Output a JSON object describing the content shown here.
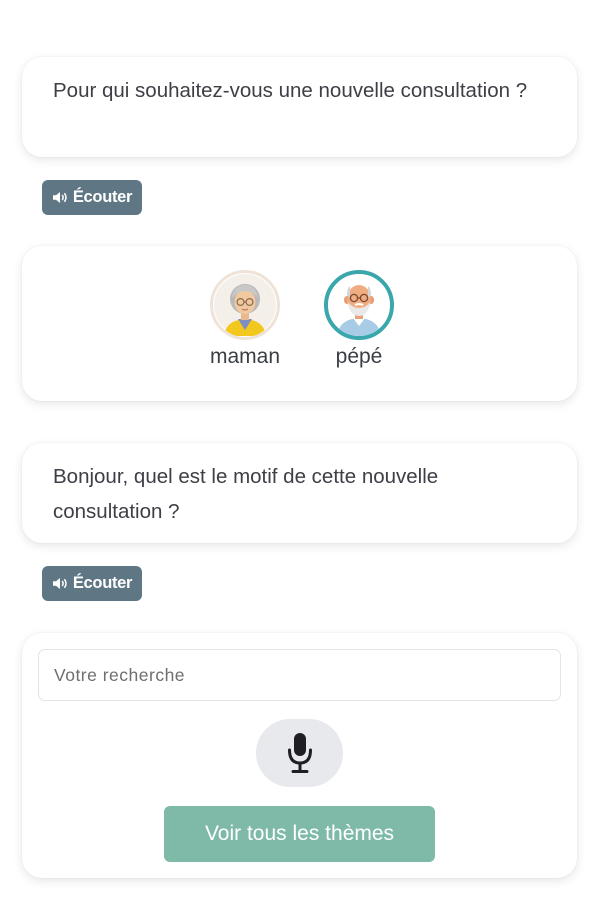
{
  "question1": {
    "text": "Pour qui souhaitez-vous une nouvelle consultation ?"
  },
  "listen1": {
    "label": "Écouter",
    "icon": "speaker-icon"
  },
  "persons": [
    {
      "label": "maman",
      "icon": "grandmother-avatar-icon",
      "selected": false
    },
    {
      "label": "pépé",
      "icon": "grandfather-avatar-icon",
      "selected": true
    }
  ],
  "question2": {
    "text": "Bonjour, quel est le motif de cette nouvelle consultation ?"
  },
  "listen2": {
    "label": "Écouter",
    "icon": "speaker-icon"
  },
  "search": {
    "placeholder": "Votre recherche",
    "value": ""
  },
  "mic": {
    "icon": "microphone-icon"
  },
  "themes_button": {
    "label": "Voir tous les thèmes"
  },
  "colors": {
    "listen_button": "#5f7784",
    "selected_ring": "#3aa7ad",
    "themes_button": "#7fbaa9",
    "mic_background": "#e8e9ec"
  }
}
